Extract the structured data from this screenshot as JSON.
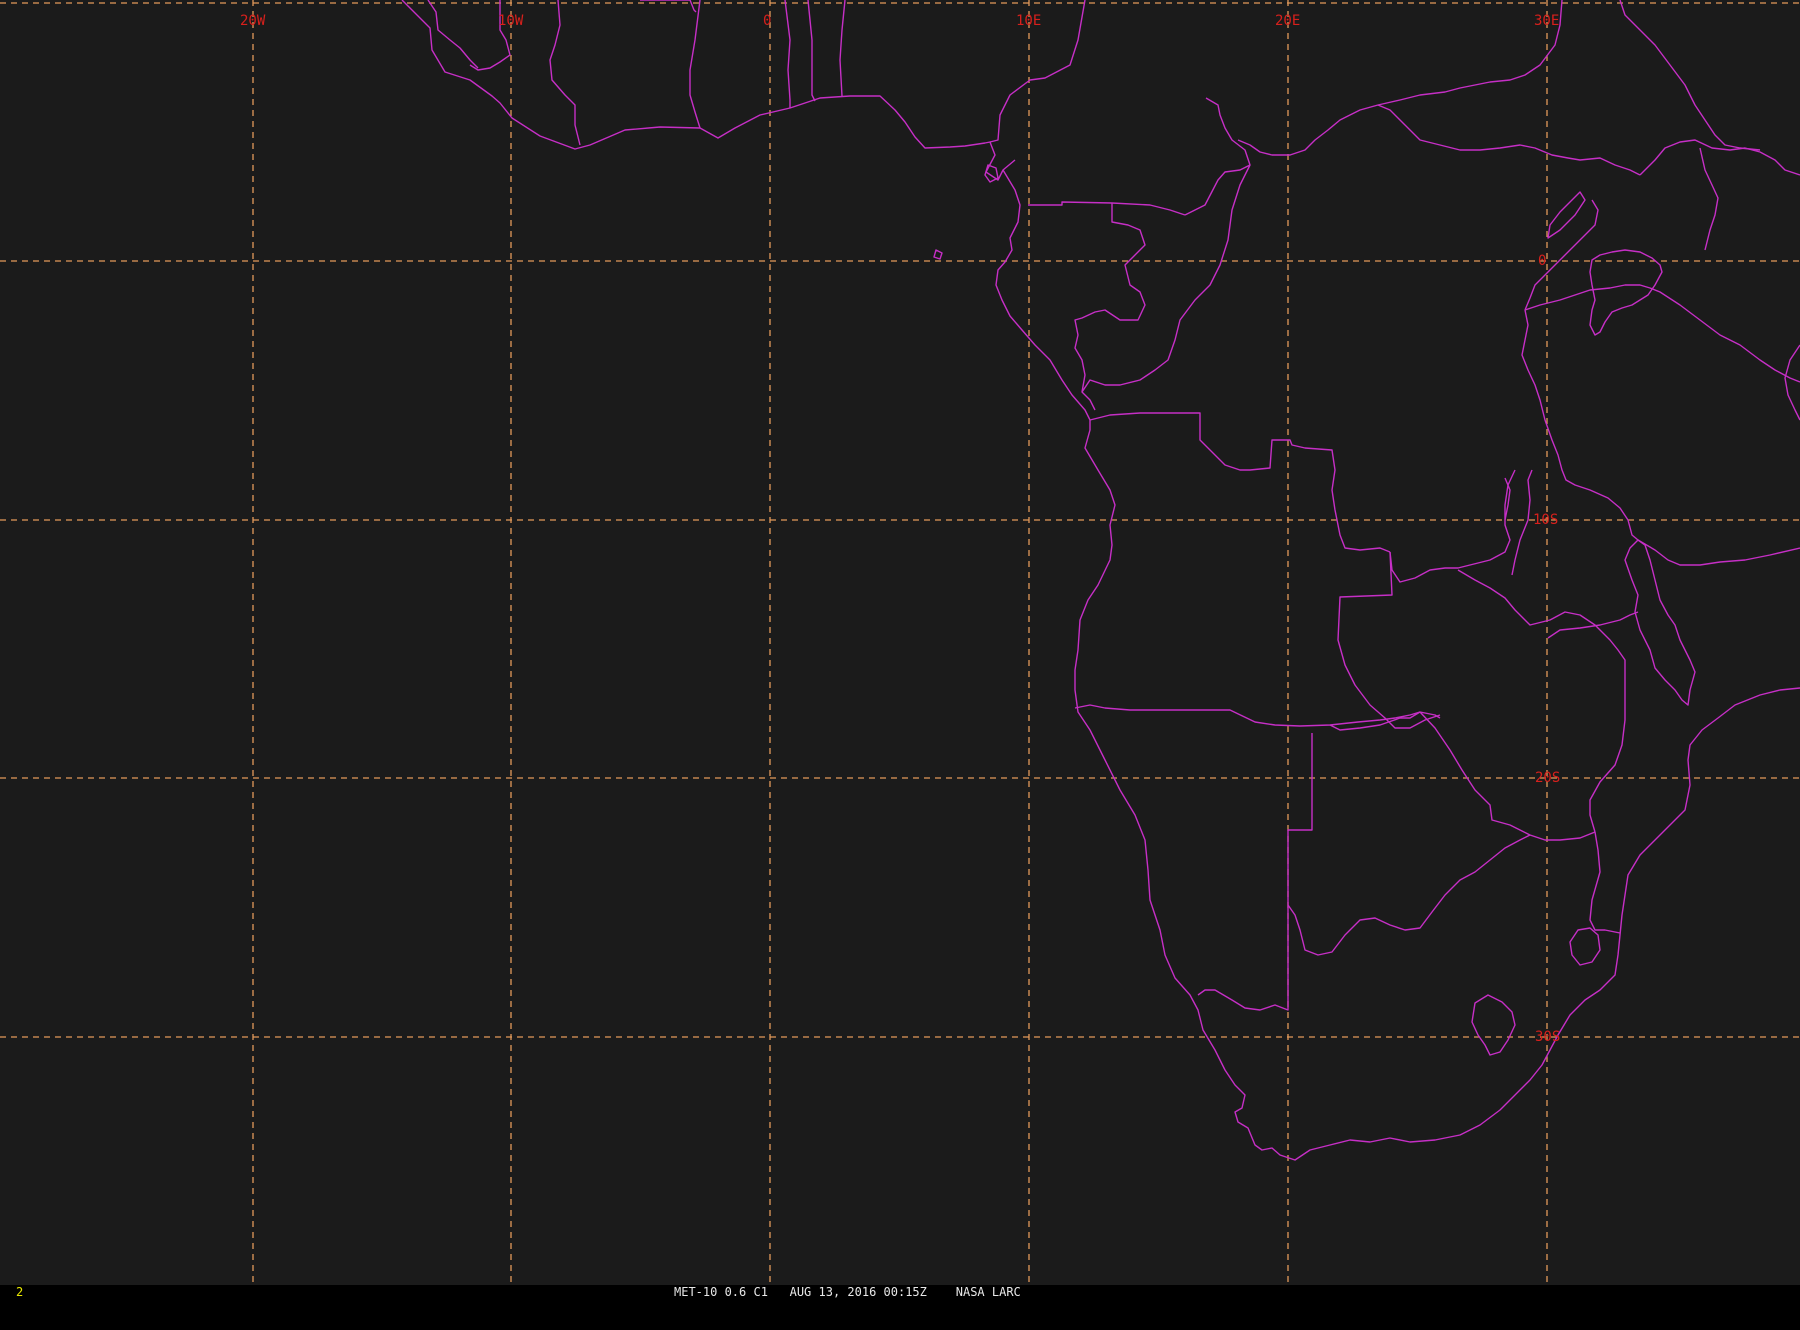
{
  "map": {
    "longitude_labels": [
      "20W",
      "10W",
      "0",
      "10E",
      "20E",
      "30E"
    ],
    "latitude_labels": [
      "0",
      "10S",
      "20S",
      "30S"
    ],
    "colors": {
      "background": "#1b1b1b",
      "grid_lines": "#e39a5a",
      "grid_labels": "#d8201c",
      "borders": "#c62fc6",
      "frame_number": "#e8e800",
      "caption_text": "#e8e8e8"
    }
  },
  "status_bar": {
    "frame_number": "2",
    "caption": "MET-10 0.6 C1   AUG 13, 2016 00:15Z    NASA LARC"
  }
}
